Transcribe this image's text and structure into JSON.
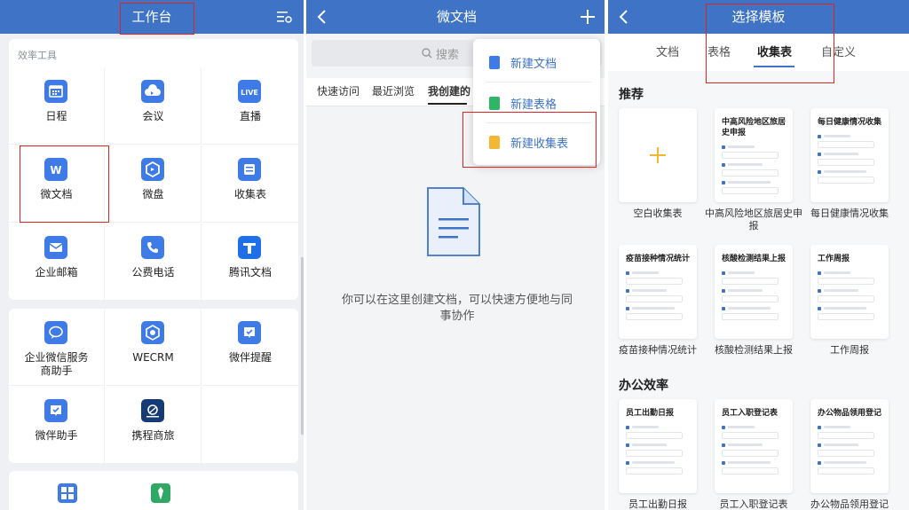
{
  "workbench": {
    "title": "工作台",
    "section_label": "效率工具",
    "apps_group1": [
      {
        "label": "日程",
        "icon": "calendar-icon",
        "color": "#3e7be6"
      },
      {
        "label": "会议",
        "icon": "cloud-meeting-icon",
        "color": "#3e7be6"
      },
      {
        "label": "直播",
        "icon": "live-icon",
        "color": "#3e7be6",
        "badge": "LIVE"
      },
      {
        "label": "微文档",
        "icon": "doc-w-icon",
        "color": "#3e7be6",
        "badge": "W"
      },
      {
        "label": "微盘",
        "icon": "drive-icon",
        "color": "#3e7be6"
      },
      {
        "label": "收集表",
        "icon": "form-icon",
        "color": "#3e7be6"
      },
      {
        "label": "企业邮箱",
        "icon": "mail-icon",
        "color": "#3e7be6"
      },
      {
        "label": "公费电话",
        "icon": "phone-icon",
        "color": "#3e7be6"
      },
      {
        "label": "腾讯文档",
        "icon": "tencent-docs-icon",
        "color": "#1e6fe8"
      }
    ],
    "apps_group2": [
      {
        "label": "企业微信服务商助手",
        "icon": "service-chat-icon",
        "color": "#3e7be6"
      },
      {
        "label": "WECRM",
        "icon": "crm-icon",
        "color": "#3e7be6"
      },
      {
        "label": "微伴提醒",
        "icon": "reminder-icon",
        "color": "#3e7be6"
      },
      {
        "label": "微伴助手",
        "icon": "assistant-icon",
        "color": "#3e7be6"
      },
      {
        "label": "携程商旅",
        "icon": "ctrip-icon",
        "color": "#163a75"
      }
    ]
  },
  "docs": {
    "title": "微文档",
    "search_placeholder": "搜索",
    "tabs": [
      "快速访问",
      "最近浏览",
      "我创建的"
    ],
    "menu": [
      {
        "label": "新建文档",
        "color": "#3e7be6"
      },
      {
        "label": "新建表格",
        "color": "#2fb566"
      },
      {
        "label": "新建收集表",
        "color": "#f3b733"
      }
    ],
    "empty_message": "你可以在这里创建文档，可以快速方便地与同事协作"
  },
  "templates": {
    "title": "选择模板",
    "tabs": [
      "文档",
      "表格",
      "收集表",
      "自定义"
    ],
    "active_tab": "收集表",
    "section_recommend": "推荐",
    "section_office": "办公效率",
    "blank_label": "空白收集表",
    "recommend": [
      {
        "title": "中高风险地区旅居史申报",
        "caption": "中高风险地区旅居史申报"
      },
      {
        "title": "每日健康情况收集",
        "caption": "每日健康情况收集"
      },
      {
        "title": "疫苗接种情况统计",
        "caption": "疫苗接种情况统计"
      },
      {
        "title": "核酸检测结果上报",
        "caption": "核酸检测结果上报"
      },
      {
        "title": "工作周报",
        "caption": "工作周报"
      }
    ],
    "office": [
      {
        "title": "员工出勤日报",
        "caption": "员工出勤日报"
      },
      {
        "title": "员工入职登记表",
        "caption": "员工入职登记表"
      },
      {
        "title": "办公物品领用登记",
        "caption": "办公物品领用登记"
      }
    ]
  }
}
